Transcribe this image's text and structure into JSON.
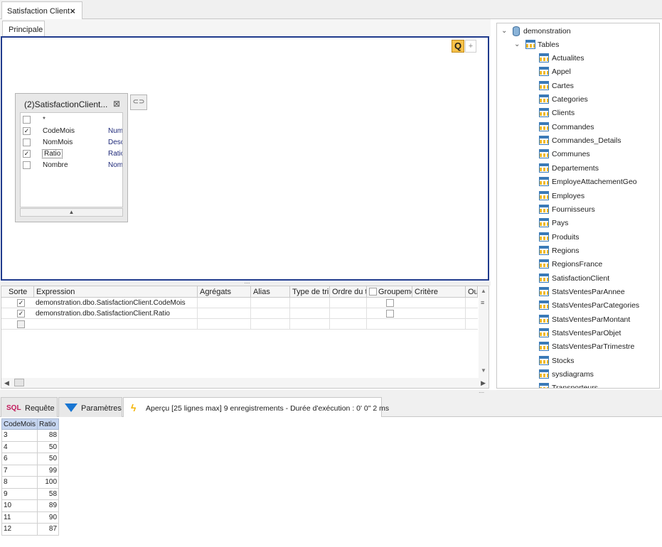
{
  "document_tab": {
    "title": "Satisfaction Client"
  },
  "inner_tab": {
    "label": "Principale"
  },
  "diagram": {
    "q_button": "Q",
    "plus_button": "+",
    "table": {
      "title": "(2)SatisfactionClient...",
      "fields": [
        {
          "name": "*",
          "type": "",
          "checked": false
        },
        {
          "name": "CodeMois",
          "type": "Num",
          "checked": true
        },
        {
          "name": "NomMois",
          "type": "Desc",
          "checked": false
        },
        {
          "name": "Ratio",
          "type": "Ratio",
          "checked": true
        },
        {
          "name": "Nombre",
          "type": "Nomb",
          "checked": false
        }
      ]
    }
  },
  "grid": {
    "headers": [
      "Sorte",
      "Expression",
      "Agrégats",
      "Alias",
      "Type de tri",
      "Ordre du tri",
      "Groupeme",
      "Critère",
      "Ou"
    ],
    "rows": [
      {
        "expression": "demonstration.dbo.SatisfactionClient.CodeMois",
        "checked": true
      },
      {
        "expression": "demonstration.dbo.SatisfactionClient.Ratio",
        "checked": true
      },
      {
        "expression": "",
        "checked": false
      }
    ]
  },
  "tree": {
    "root": "demonstration",
    "folder": "Tables",
    "tables": [
      "Actualites",
      "Appel",
      "Cartes",
      "Categories",
      "Clients",
      "Commandes",
      "Commandes_Details",
      "Communes",
      "Departements",
      "EmployeAttachementGeo",
      "Employes",
      "Fournisseurs",
      "Pays",
      "Produits",
      "Regions",
      "RegionsFrance",
      "SatisfactionClient",
      "StatsVentesParAnnee",
      "StatsVentesParCategories",
      "StatsVentesParMontant",
      "StatsVentesParObjet",
      "StatsVentesParTrimestre",
      "Stocks",
      "sysdiagrams",
      "Transporteurs"
    ]
  },
  "bottom_tabs": {
    "requete": {
      "badge": "SQL",
      "label": "Requête"
    },
    "parametres": {
      "label": "Paramètres"
    },
    "apercu": {
      "label": "Aperçu [25 lignes max] 9 enregistrements - Durée d'exécution : 0' 0\" 2 ms"
    }
  },
  "results": {
    "columns": [
      "CodeMois",
      "Ratio"
    ],
    "rows": [
      [
        "3",
        "88"
      ],
      [
        "4",
        "50"
      ],
      [
        "6",
        "50"
      ],
      [
        "7",
        "99"
      ],
      [
        "8",
        "100"
      ],
      [
        "9",
        "58"
      ],
      [
        "10",
        "89"
      ],
      [
        "11",
        "90"
      ],
      [
        "12",
        "87"
      ]
    ]
  }
}
